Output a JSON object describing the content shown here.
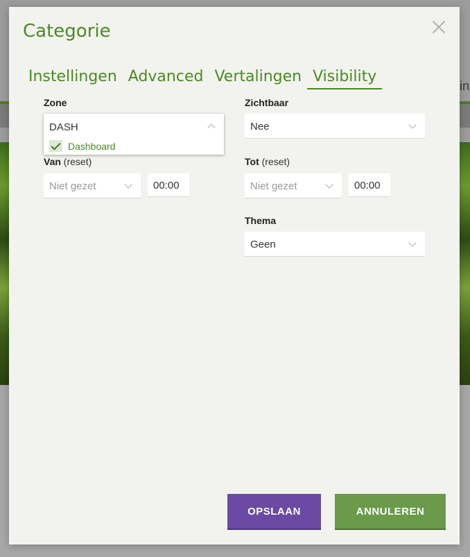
{
  "background": {
    "edge_text": "in"
  },
  "modal": {
    "title": "Categorie",
    "tabs": [
      {
        "label": "Instellingen",
        "active": false
      },
      {
        "label": "Advanced",
        "active": false
      },
      {
        "label": "Vertalingen",
        "active": false
      },
      {
        "label": "Visibility",
        "active": true
      }
    ],
    "zone": {
      "label": "Zone",
      "value": "DASH",
      "options": [
        {
          "label": "Dashboard",
          "checked": true
        }
      ]
    },
    "zichtbaar": {
      "label": "Zichtbaar",
      "value": "Nee"
    },
    "van": {
      "label": "Van",
      "reset": "(reset)",
      "date_placeholder": "Niet gezet",
      "time": "00:00"
    },
    "tot": {
      "label": "Tot",
      "reset": "(reset)",
      "date_placeholder": "Niet gezet",
      "time": "00:00"
    },
    "thema": {
      "label": "Thema",
      "value": "Geen"
    },
    "buttons": {
      "save": "OPSLAAN",
      "cancel": "ANNULEREN"
    }
  },
  "colors": {
    "accent_green": "#4a8a23",
    "save_purple": "#6a4aa2",
    "cancel_green": "#6a9a4a"
  },
  "icons": {
    "close": "close-icon",
    "chevron": "chevron-down-icon",
    "check": "check-icon"
  }
}
